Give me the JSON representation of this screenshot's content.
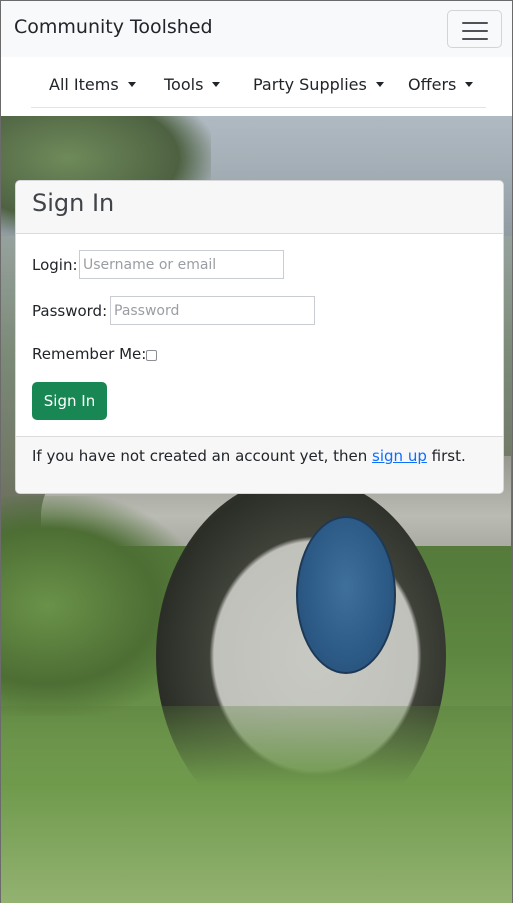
{
  "navbar": {
    "brand": "Community Toolshed",
    "toggler_icon": "hamburger-menu-icon"
  },
  "subnav": {
    "items": [
      {
        "label": "All Items"
      },
      {
        "label": "Tools"
      },
      {
        "label": "Party Supplies"
      },
      {
        "label": "Offers"
      }
    ],
    "caret_icon": "caret-down-icon"
  },
  "signin": {
    "title": "Sign In",
    "login_label": "Login:",
    "login_placeholder": "Username or email",
    "login_value": "",
    "password_label": "Password:",
    "password_placeholder": "Password",
    "password_value": "",
    "remember_label": "Remember Me:",
    "remember_checked": false,
    "submit_label": "Sign In",
    "footer_prefix": "If you have not created an account yet, then",
    "footer_link": "sign up",
    "footer_suffix": "first."
  },
  "colors": {
    "primary_button": "#198754",
    "link": "#0d6efd",
    "navbar_bg": "#f8f9fa"
  }
}
